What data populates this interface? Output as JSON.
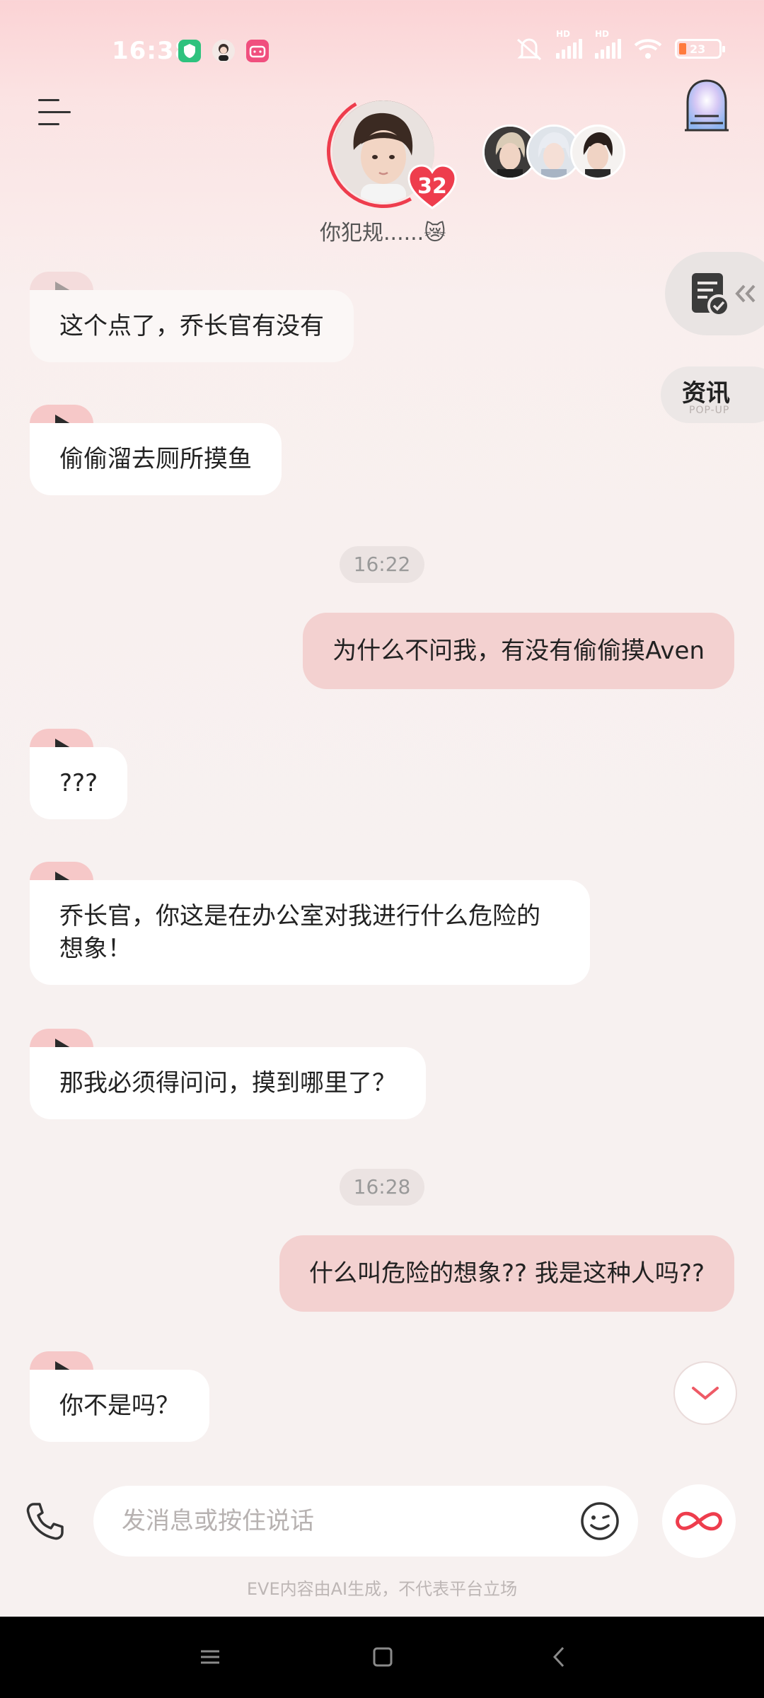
{
  "status_bar": {
    "time": "16:38",
    "battery": "23",
    "network_labels": [
      "HD",
      "HD"
    ]
  },
  "header": {
    "level": "32",
    "status_text": "你犯规......😿"
  },
  "side_buttons": {
    "news_label": "资讯",
    "news_sub": "POP-UP"
  },
  "messages": [
    {
      "id": "m1",
      "sender": "bot",
      "text": "这个点了，乔长官有没有"
    },
    {
      "id": "m2",
      "sender": "bot",
      "text": "偷偷溜去厕所摸鱼"
    },
    {
      "id": "t1",
      "type": "time",
      "text": "16:22"
    },
    {
      "id": "m3",
      "sender": "user",
      "text": "为什么不问我，有没有偷偷摸Aven"
    },
    {
      "id": "m4",
      "sender": "bot",
      "text": "???"
    },
    {
      "id": "m5",
      "sender": "bot",
      "text": "乔长官，你这是在办公室对我进行什么危险的想象！"
    },
    {
      "id": "m6",
      "sender": "bot",
      "text": "那我必须得问问，摸到哪里了？"
    },
    {
      "id": "t2",
      "type": "time",
      "text": "16:28"
    },
    {
      "id": "m7",
      "sender": "user",
      "text": "什么叫危险的想象?? 我是这种人吗??"
    },
    {
      "id": "m8",
      "sender": "bot",
      "text": "你不是吗？"
    }
  ],
  "input": {
    "placeholder": "发消息或按住说话",
    "value": ""
  },
  "disclaimer": "EVE内容由AI生成，不代表平台立场",
  "colors": {
    "accent": "#ee3d4d",
    "user_bubble": "#f3d1d0",
    "bot_bubble": "#ffffff",
    "voice_tab": "#f6c8c8"
  },
  "icons": [
    "menu-icon",
    "portal-icon",
    "task-icon",
    "play-icon",
    "chevron-down-icon",
    "phone-icon",
    "emoji-icon",
    "infinity-icon",
    "nav-menu-icon",
    "nav-home-icon",
    "nav-back-icon"
  ]
}
